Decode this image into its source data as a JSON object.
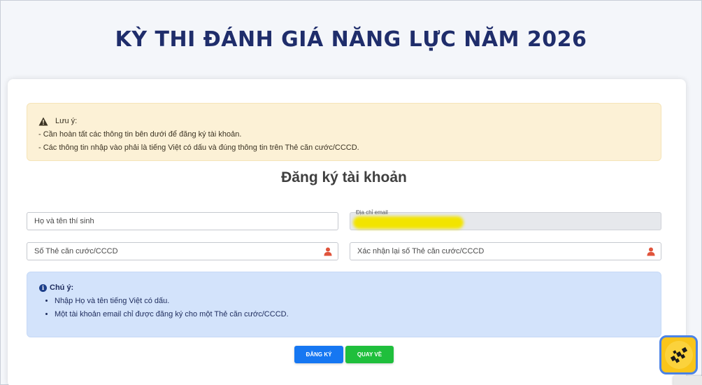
{
  "page": {
    "title": "KỲ THI ĐÁNH GIÁ NĂNG LỰC NĂM 2026"
  },
  "warning": {
    "icon": "warning-triangle-icon",
    "heading": "Lưu ý:",
    "lines": [
      "- Cần hoàn tất các thông tin bên dưới để đăng ký tài khoản.",
      "- Các thông tin nhập vào phải là tiếng Việt có dấu và đúng thông tin trên Thẻ căn cước/CCCD."
    ]
  },
  "form": {
    "title": "Đăng ký tài khoản",
    "full_name_placeholder": "Họ và tên thí sinh",
    "email_label": "Địa chỉ email",
    "id_card_placeholder": "Số Thẻ căn cước/CCCD",
    "id_card_confirm_placeholder": "Xác nhận lại số Thẻ căn cước/CCCD"
  },
  "note": {
    "icon": "info-circle-icon",
    "heading": "Chú ý:",
    "items": [
      "Nhập Họ và tên tiếng Việt có dấu.",
      "Một tài khoản email chỉ được đăng ký cho một Thẻ căn cước/CCCD."
    ]
  },
  "buttons": {
    "register_label": "ĐĂNG KÝ",
    "back_label": "QUAY VỀ"
  },
  "colors": {
    "title": "#1f2d6b",
    "warning_bg": "#fcf1d6",
    "info_bg": "#d3e3fb",
    "register_button": "#1677f2",
    "back_button": "#1fbf3c",
    "user_icon": "#e0533b"
  }
}
